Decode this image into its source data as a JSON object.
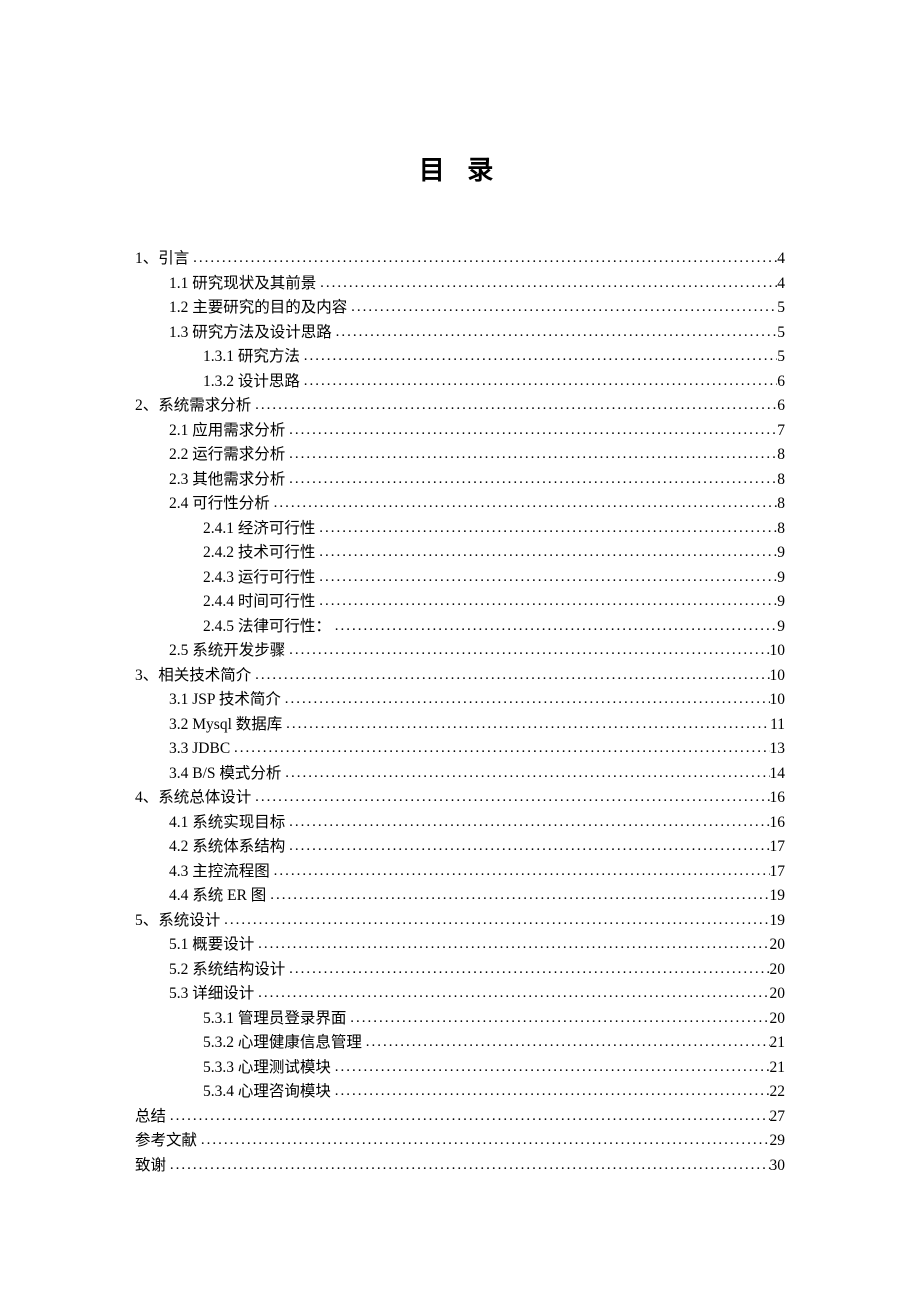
{
  "title": "目 录",
  "entries": [
    {
      "level": 0,
      "label": "1、引言",
      "page": "4"
    },
    {
      "level": 1,
      "label": "1.1 研究现状及其前景",
      "page": "4"
    },
    {
      "level": 1,
      "label": "1.2 主要研究的目的及内容",
      "page": "5"
    },
    {
      "level": 1,
      "label": "1.3 研究方法及设计思路",
      "page": "5"
    },
    {
      "level": 2,
      "label": "1.3.1 研究方法",
      "page": "5"
    },
    {
      "level": 2,
      "label": "1.3.2 设计思路",
      "page": "6"
    },
    {
      "level": 0,
      "label": "2、系统需求分析",
      "page": "6"
    },
    {
      "level": 1,
      "label": "2.1 应用需求分析",
      "page": "7"
    },
    {
      "level": 1,
      "label": "2.2 运行需求分析",
      "page": "8"
    },
    {
      "level": 1,
      "label": "2.3 其他需求分析",
      "page": "8"
    },
    {
      "level": 1,
      "label": "2.4 可行性分析",
      "page": "8"
    },
    {
      "level": 2,
      "label": "2.4.1 经济可行性",
      "page": "8"
    },
    {
      "level": 2,
      "label": "2.4.2 技术可行性",
      "page": "9"
    },
    {
      "level": 2,
      "label": "2.4.3 运行可行性",
      "page": "9"
    },
    {
      "level": 2,
      "label": "2.4.4 时间可行性",
      "page": "9"
    },
    {
      "level": 2,
      "label": "2.4.5 法律可行性：",
      "page": "9"
    },
    {
      "level": 1,
      "label": "2.5 系统开发步骤",
      "page": "10"
    },
    {
      "level": 0,
      "label": "3、相关技术简介",
      "page": "10"
    },
    {
      "level": 1,
      "label": "3.1 JSP 技术简介",
      "page": "10"
    },
    {
      "level": 1,
      "label": "3.2 Mysql 数据库",
      "page": "11"
    },
    {
      "level": 1,
      "label": "3.3 JDBC",
      "page": "13"
    },
    {
      "level": 1,
      "label": "3.4 B/S 模式分析",
      "page": "14"
    },
    {
      "level": 0,
      "label": "4、系统总体设计",
      "page": "16"
    },
    {
      "level": 1,
      "label": "4.1 系统实现目标",
      "page": "16"
    },
    {
      "level": 1,
      "label": "4.2 系统体系结构",
      "page": "17"
    },
    {
      "level": 1,
      "label": "4.3 主控流程图",
      "page": "17"
    },
    {
      "level": 1,
      "label": "4.4 系统 ER 图",
      "page": "19"
    },
    {
      "level": 0,
      "label": "5、系统设计",
      "page": "19"
    },
    {
      "level": 1,
      "label": "5.1 概要设计",
      "page": "20"
    },
    {
      "level": 1,
      "label": "5.2 系统结构设计",
      "page": "20"
    },
    {
      "level": 1,
      "label": "5.3 详细设计",
      "page": "20"
    },
    {
      "level": 2,
      "label": "5.3.1 管理员登录界面",
      "page": "20"
    },
    {
      "level": 2,
      "label": "5.3.2 心理健康信息管理",
      "page": "21"
    },
    {
      "level": 2,
      "label": "5.3.3 心理测试模块",
      "page": "21"
    },
    {
      "level": 2,
      "label": "5.3.4 心理咨询模块",
      "page": "22"
    },
    {
      "level": 0,
      "label": "总结",
      "page": "27"
    },
    {
      "level": 0,
      "label": "参考文献",
      "page": "29"
    },
    {
      "level": 0,
      "label": "致谢",
      "page": "30"
    }
  ]
}
